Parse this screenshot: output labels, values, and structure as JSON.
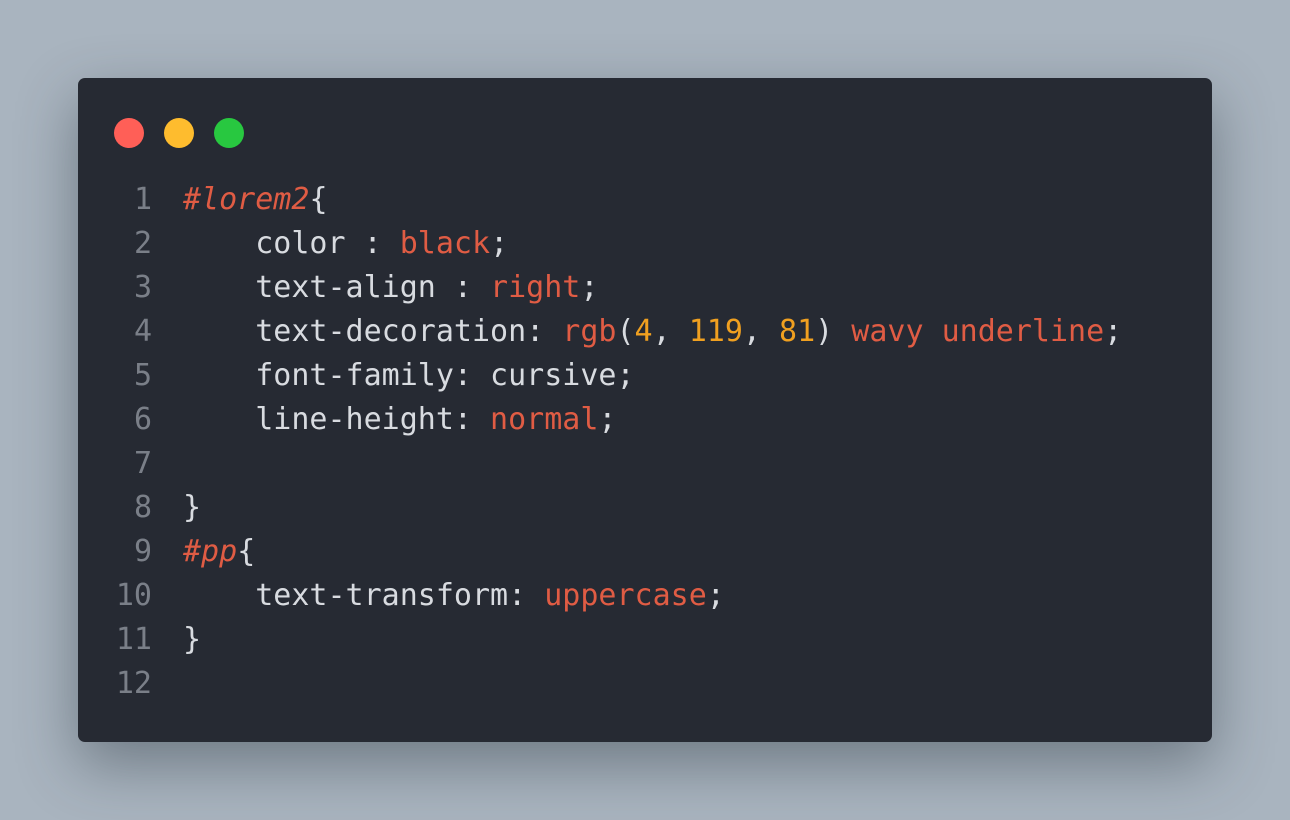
{
  "colors": {
    "background": "#a9b4bf",
    "window": "#262a33",
    "line_number": "#7a7f88",
    "text": "#d8dbe0",
    "selector": "#e05c44",
    "value": "#e05c44",
    "number": "#f0a020",
    "dot_close": "#ff5f57",
    "dot_minimize": "#febc2e",
    "dot_maximize": "#28c840"
  },
  "window_controls": [
    {
      "name": "close-dot",
      "color": "#ff5f57"
    },
    {
      "name": "minimize-dot",
      "color": "#febc2e"
    },
    {
      "name": "maximize-dot",
      "color": "#28c840"
    }
  ],
  "lines": [
    {
      "num": "1",
      "tokens": [
        {
          "t": "#lorem2",
          "k": "sel"
        },
        {
          "t": "{",
          "k": "punct"
        }
      ]
    },
    {
      "num": "2",
      "tokens": [
        {
          "t": "    color : ",
          "k": "prop"
        },
        {
          "t": "black",
          "k": "val"
        },
        {
          "t": ";",
          "k": "punct"
        }
      ]
    },
    {
      "num": "3",
      "tokens": [
        {
          "t": "    text-align : ",
          "k": "prop"
        },
        {
          "t": "right",
          "k": "val"
        },
        {
          "t": ";",
          "k": "punct"
        }
      ]
    },
    {
      "num": "4",
      "tokens": [
        {
          "t": "    text-decoration: ",
          "k": "prop"
        },
        {
          "t": "rgb",
          "k": "val"
        },
        {
          "t": "(",
          "k": "punct"
        },
        {
          "t": "4",
          "k": "num"
        },
        {
          "t": ", ",
          "k": "punct"
        },
        {
          "t": "119",
          "k": "num"
        },
        {
          "t": ", ",
          "k": "punct"
        },
        {
          "t": "81",
          "k": "num"
        },
        {
          "t": ") ",
          "k": "punct"
        },
        {
          "t": "wavy underline",
          "k": "val"
        },
        {
          "t": ";",
          "k": "punct"
        }
      ]
    },
    {
      "num": "5",
      "tokens": [
        {
          "t": "    font-family: cursive;",
          "k": "prop"
        }
      ]
    },
    {
      "num": "6",
      "tokens": [
        {
          "t": "    line-height: ",
          "k": "prop"
        },
        {
          "t": "normal",
          "k": "val"
        },
        {
          "t": ";",
          "k": "punct"
        }
      ]
    },
    {
      "num": "7",
      "tokens": []
    },
    {
      "num": "8",
      "tokens": [
        {
          "t": "}",
          "k": "punct"
        }
      ]
    },
    {
      "num": "9",
      "tokens": [
        {
          "t": "#pp",
          "k": "sel"
        },
        {
          "t": "{",
          "k": "punct"
        }
      ]
    },
    {
      "num": "10",
      "tokens": [
        {
          "t": "    text-transform: ",
          "k": "prop"
        },
        {
          "t": "uppercase",
          "k": "val"
        },
        {
          "t": ";",
          "k": "punct"
        }
      ]
    },
    {
      "num": "11",
      "tokens": [
        {
          "t": "}",
          "k": "punct"
        }
      ]
    },
    {
      "num": "12",
      "tokens": []
    }
  ]
}
